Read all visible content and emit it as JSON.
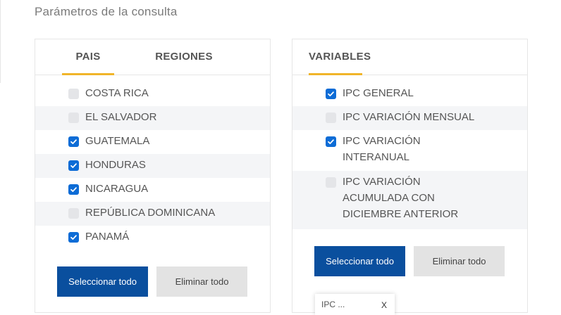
{
  "page": {
    "section_title": "Parámetros de la consulta"
  },
  "country_panel": {
    "tabs": [
      {
        "label": "PAIS",
        "active": true
      },
      {
        "label": "REGIONES",
        "active": false
      }
    ],
    "items": [
      {
        "label": "COSTA RICA",
        "checked": false
      },
      {
        "label": "EL SALVADOR",
        "checked": false
      },
      {
        "label": "GUATEMALA",
        "checked": true
      },
      {
        "label": "HONDURAS",
        "checked": true
      },
      {
        "label": "NICARAGUA",
        "checked": true
      },
      {
        "label": "REPÚBLICA DOMINICANA",
        "checked": false
      },
      {
        "label": "PANAMÁ",
        "checked": true
      }
    ],
    "select_all_label": "Seleccionar todo",
    "remove_all_label": "Eliminar todo"
  },
  "variables_panel": {
    "tabs": [
      {
        "label": "VARIABLES",
        "active": true
      }
    ],
    "items": [
      {
        "label": "IPC GENERAL",
        "checked": true
      },
      {
        "label": "IPC VARIACIÓN MENSUAL",
        "checked": false
      },
      {
        "label": "IPC VARIACIÓN INTERANUAL",
        "checked": true
      },
      {
        "label": "IPC VARIACIÓN ACUMULADA CON DICIEMBRE ANTERIOR",
        "checked": false
      }
    ],
    "select_all_label": "Seleccionar todo",
    "remove_all_label": "Eliminar todo"
  },
  "selected_chip": {
    "label": "IPC ...",
    "close_glyph": "X"
  },
  "colors": {
    "accent_underline": "#f0b429",
    "primary_button": "#0a4f9e",
    "checkbox_checked": "#0d6cd6"
  }
}
